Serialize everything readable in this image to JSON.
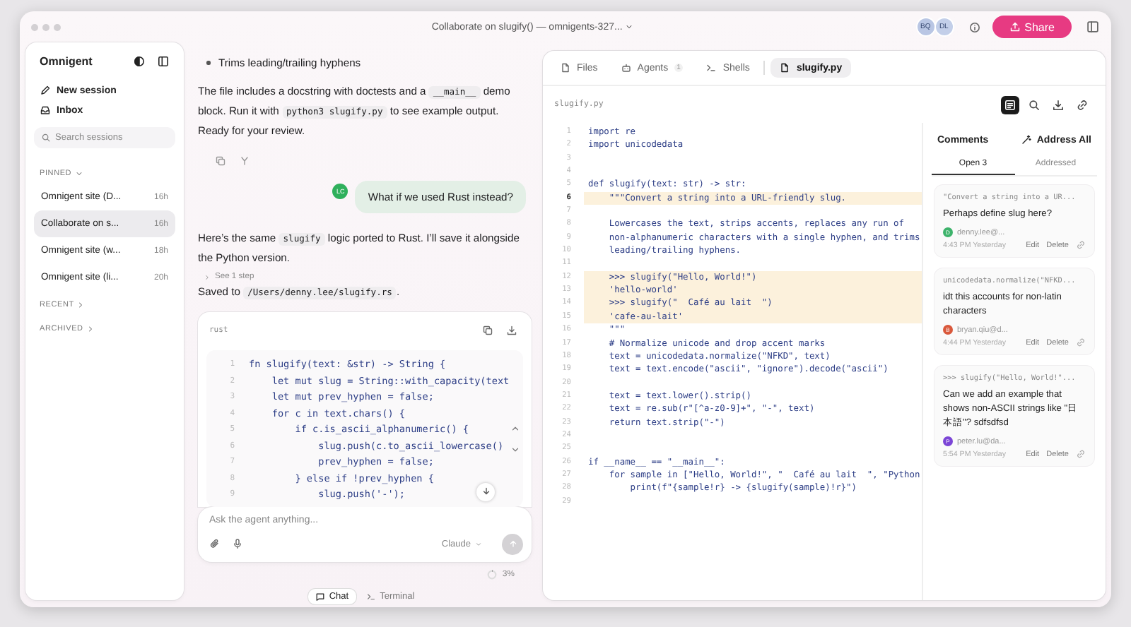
{
  "window": {
    "title": "Collaborate on slugify() — omnigents-327...",
    "collaborators": [
      {
        "initials": "BQ",
        "color": "#b9c6e4"
      },
      {
        "initials": "DL",
        "color": "#c3cfe9"
      }
    ],
    "share_button": "Share"
  },
  "sidebar": {
    "title": "Omnigent",
    "actions": [
      {
        "kind": "new",
        "label": "New session"
      },
      {
        "kind": "inbox",
        "label": "Inbox"
      }
    ],
    "search": {
      "placeholder": "Search sessions"
    },
    "groups": [
      {
        "label": "PINNED",
        "expanded": true,
        "sessions": [
          {
            "title": "Omnigent site (D...",
            "age": "16h",
            "selected": false
          },
          {
            "title": "Collaborate on s...",
            "age": "16h",
            "selected": true
          },
          {
            "title": "Omnigent site (w...",
            "age": "18h",
            "selected": false
          },
          {
            "title": "Omnigent site (li...",
            "age": "20h",
            "selected": false
          }
        ]
      },
      {
        "label": "RECENT",
        "expanded": false
      },
      {
        "label": "ARCHIVED",
        "expanded": false
      }
    ]
  },
  "chat": {
    "bullet": "Trims leading/trailing hyphens",
    "summary": [
      {
        "kind": "text",
        "text": "The file includes a docstring with doctests and a "
      },
      {
        "kind": "code",
        "text": "__main__"
      },
      {
        "kind": "text",
        "text": " demo block. Run it with "
      },
      {
        "kind": "code",
        "text": "python3 slugify.py"
      },
      {
        "kind": "text",
        "text": " to see example output. Ready for your review."
      }
    ],
    "user_message": {
      "initials": "LC",
      "text": "What if we used Rust instead?"
    },
    "reply": [
      {
        "kind": "text",
        "text": "Here’s the same "
      },
      {
        "kind": "code",
        "text": "slugify"
      },
      {
        "kind": "text",
        "text": " logic ported to Rust. I’ll save it alongside the Python version."
      }
    ],
    "steps": "See 1 step",
    "saved": [
      {
        "kind": "text",
        "text": "Saved to "
      },
      {
        "kind": "code",
        "text": "/Users/denny.lee/slugify.rs"
      },
      {
        "kind": "text",
        "text": "."
      }
    ],
    "code_block": {
      "language": "rust",
      "lines": [
        {
          "number": "1",
          "text": "fn slugify(text: &str) -> String {"
        },
        {
          "number": "2",
          "text": "    let mut slug = String::with_capacity(text"
        },
        {
          "number": "3",
          "text": "    let mut prev_hyphen = false;"
        },
        {
          "number": "4",
          "text": "    for c in text.chars() {"
        },
        {
          "number": "5",
          "text": "        if c.is_ascii_alphanumeric() {"
        },
        {
          "number": "6",
          "text": "            slug.push(c.to_ascii_lowercase()"
        },
        {
          "number": "7",
          "text": "            prev_hyphen = false;"
        },
        {
          "number": "8",
          "text": "        } else if !prev_hyphen {"
        },
        {
          "number": "9",
          "text": "            slug.push('-');"
        }
      ]
    },
    "composer": {
      "placeholder": "Ask the agent anything...",
      "model": "Claude",
      "send_disabled": true
    },
    "context": {
      "level": 0.03,
      "reading": "3%"
    },
    "views": [
      {
        "label": "Chat",
        "kind": "chat",
        "selected": true
      },
      {
        "label": "Terminal",
        "kind": "terminal",
        "selected": false
      }
    ]
  },
  "editor": {
    "tabs": [
      {
        "label": "Files",
        "kind": "files",
        "selected": false
      },
      {
        "label": "Agents",
        "kind": "agents",
        "count": "1",
        "selected": false
      },
      {
        "label": "Shells",
        "kind": "shells",
        "selected": false
      },
      {
        "label": "slugify.py",
        "kind": "file",
        "selected": true
      }
    ],
    "path": "slugify.py",
    "toolbar": [
      {
        "kind": "comments",
        "selected": true
      },
      {
        "kind": "search",
        "selected": false
      },
      {
        "kind": "download",
        "selected": false
      },
      {
        "kind": "link",
        "selected": false
      }
    ],
    "lines": [
      {
        "number": "1",
        "text": "import re",
        "highlighted": false,
        "current": false
      },
      {
        "number": "2",
        "text": "import unicodedata",
        "highlighted": false,
        "current": false
      },
      {
        "number": "3",
        "highlighted": false,
        "current": false
      },
      {
        "number": "4",
        "highlighted": false,
        "current": false
      },
      {
        "number": "5",
        "text": "def slugify(text: str) -> str:",
        "highlighted": false,
        "current": false
      },
      {
        "number": "6",
        "text": "    \"\"\"Convert a string into a URL-friendly slug.",
        "highlighted": true,
        "current": true
      },
      {
        "number": "7",
        "highlighted": false,
        "current": false
      },
      {
        "number": "8",
        "text": "    Lowercases the text, strips accents, replaces any run of",
        "highlighted": false,
        "current": false
      },
      {
        "number": "9",
        "text": "    non-alphanumeric characters with a single hyphen, and trims",
        "highlighted": false,
        "current": false
      },
      {
        "number": "10",
        "text": "    leading/trailing hyphens.",
        "highlighted": false,
        "current": false
      },
      {
        "number": "11",
        "highlighted": false,
        "current": false
      },
      {
        "number": "12",
        "text": "    >>> slugify(\"Hello, World!\")",
        "highlighted": true,
        "current": false
      },
      {
        "number": "13",
        "text": "    'hello-world'",
        "highlighted": true,
        "current": false
      },
      {
        "number": "14",
        "text": "    >>> slugify(\"  Café au lait  \")",
        "highlighted": true,
        "current": false
      },
      {
        "number": "15",
        "text": "    'cafe-au-lait'",
        "highlighted": true,
        "current": false
      },
      {
        "number": "16",
        "text": "    \"\"\"",
        "highlighted": false,
        "current": false
      },
      {
        "number": "17",
        "text": "    # Normalize unicode and drop accent marks",
        "highlighted": false,
        "current": false
      },
      {
        "number": "18",
        "text": "    text = unicodedata.normalize(\"NFKD\", text)",
        "highlighted": false,
        "current": false
      },
      {
        "number": "19",
        "text": "    text = text.encode(\"ascii\", \"ignore\").decode(\"ascii\")",
        "highlighted": false,
        "current": false
      },
      {
        "number": "20",
        "highlighted": false,
        "current": false
      },
      {
        "number": "21",
        "text": "    text = text.lower().strip()",
        "highlighted": false,
        "current": false
      },
      {
        "number": "22",
        "text": "    text = re.sub(r\"[^a-z0-9]+\", \"-\", text)",
        "highlighted": false,
        "current": false
      },
      {
        "number": "23",
        "text": "    return text.strip(\"-\")",
        "highlighted": false,
        "current": false
      },
      {
        "number": "24",
        "highlighted": false,
        "current": false
      },
      {
        "number": "25",
        "highlighted": false,
        "current": false
      },
      {
        "number": "26",
        "text": "if __name__ == \"__main__\":",
        "highlighted": false,
        "current": false
      },
      {
        "number": "27",
        "text": "    for sample in [\"Hello, World!\", \"  Café au lait  \", \"Python",
        "highlighted": false,
        "current": false
      },
      {
        "number": "28",
        "text": "        print(f\"{sample!r} -> {slugify(sample)!r}\")",
        "highlighted": false,
        "current": false
      },
      {
        "number": "29",
        "highlighted": false,
        "current": false
      }
    ],
    "comments": {
      "title": "Comments",
      "address_all": "Address All",
      "tabs": [
        {
          "label": "Open",
          "count": "3",
          "selected": true
        },
        {
          "label": "Addressed",
          "selected": false
        }
      ],
      "items": [
        {
          "quote": "\"Convert a string into a UR...",
          "text": "Perhaps define slug here?",
          "initial": "D",
          "color": "#3db36b",
          "author": "denny.lee@...",
          "time": "4:43 PM Yesterday",
          "edit": "Edit",
          "delete": "Delete"
        },
        {
          "quote": "unicodedata.normalize(\"NFKD...",
          "text": "idt this accounts for non-latin characters",
          "initial": "B",
          "color": "#d9583b",
          "author": "bryan.qiu@d...",
          "time": "4:44 PM Yesterday",
          "edit": "Edit",
          "delete": "Delete"
        },
        {
          "quote": ">>> slugify(\"Hello, World!\"...",
          "text": "Can we add an example that shows non-ASCII strings like \"日本語\"? sdfsdfsd",
          "initial": "P",
          "color": "#7b45d6",
          "author": "peter.lu@da...",
          "time": "5:54 PM Yesterday",
          "edit": "Edit",
          "delete": "Delete"
        }
      ]
    }
  }
}
